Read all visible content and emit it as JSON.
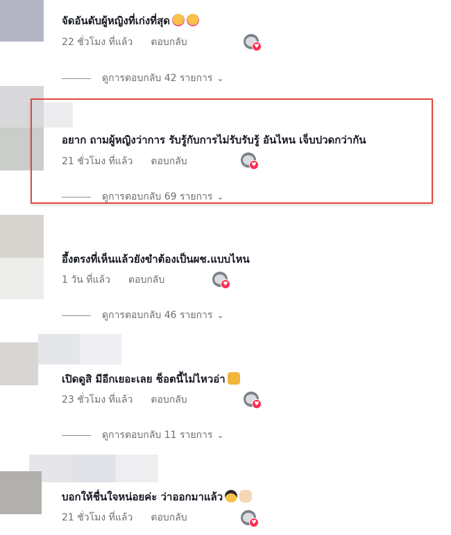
{
  "comments": [
    {
      "text": "จัดอันดับผู้หญิงที่เก่งที่สุด",
      "emojis": [
        "smiling-face-with-hearts",
        "smiling-face-with-hearts"
      ],
      "time": "22 ชั่วโมง ที่แล้ว",
      "reply_label": "ตอบกลับ",
      "view_replies": "ดูการตอบกลับ 42 รายการ"
    },
    {
      "text": "อยาก ถามผู้หญิงว่าการ รับรู้กับการไม่รับรับรู้ อันไหน เจ็บปวดกว่ากัน",
      "emojis": [],
      "time": "21 ชั่วโมง ที่แล้ว",
      "reply_label": "ตอบกลับ",
      "view_replies": "ดูการตอบกลับ 69 รายการ"
    },
    {
      "text": "อึ้งตรงที่เห็นแล้วยังขำต้องเป็นผช.แบบไหน",
      "emojis": [],
      "time": "1 วัน ที่แล้ว",
      "reply_label": "ตอบกลับ",
      "view_replies": "ดูการตอบกลับ 46 รายการ"
    },
    {
      "text": "เปิดดูสิ มีอีกเยอะเลย ช็อตนี้ไม่ไหวอ่า",
      "emojis": [
        "crying-cat"
      ],
      "time": "23 ชั่วโมง ที่แล้ว",
      "reply_label": "ตอบกลับ",
      "view_replies": "ดูการตอบกลับ 11 รายการ"
    },
    {
      "text": "บอกให้ชื่นใจหน่อยค่ะ ว่าออกมาแล้ว",
      "emojis": [
        "smiling-face-with-sunglasses",
        "victory-hand"
      ],
      "time": "21 ชั่วโมง ที่แล้ว",
      "reply_label": "ตอบกลับ",
      "view_replies": ""
    }
  ],
  "colors": {
    "text": "#161823",
    "meta": "#6b6d72",
    "highlight_border": "#e0463e",
    "like_badge": "#fe2c55"
  },
  "icons": {
    "chevron": "chevron-down-icon",
    "creator_like": "creator-liked-avatar-icon"
  }
}
